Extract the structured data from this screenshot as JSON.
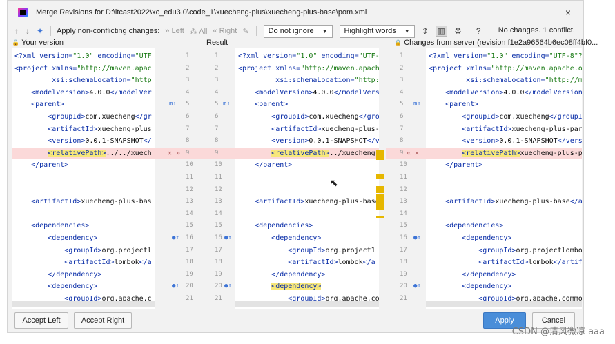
{
  "window": {
    "title": "Merge Revisions for D:\\itcast2022\\xc_edu3.0\\code_1\\xuecheng-plus\\xuecheng-plus-base\\pom.xml",
    "close_icon": "×"
  },
  "toolbar": {
    "up_icon": "↑",
    "down_icon": "↓",
    "magic_icon": "✦",
    "apply_label": "Apply non-conflicting changes:",
    "left_label": "» Left",
    "all_label": "⁂ All",
    "right_label": "« Right",
    "ignore_dropdown": "Do not ignore",
    "highlight_dropdown": "Highlight words",
    "status_text": "No changes. 1 conflict.",
    "help_icon": "?"
  },
  "columns": {
    "left": "Your version",
    "center": "Result",
    "right": "Changes from server (revision f1e2a96564b6ec08ff4bf0..."
  },
  "editor_left": [
    {
      "n": "1",
      "segs": [
        [
          "pi",
          "<?xml version="
        ],
        [
          "val",
          "\"1.0\""
        ],
        [
          "pi",
          " encoding="
        ],
        [
          "val",
          "\"UTF"
        ]
      ]
    },
    {
      "n": "2",
      "segs": [
        [
          "tag",
          "<project"
        ],
        [
          "attr",
          " xmlns="
        ],
        [
          "val",
          "\"http://maven.apac"
        ]
      ]
    },
    {
      "n": "3",
      "segs": [
        [
          "attr",
          "         xsi:schemaLocation="
        ],
        [
          "val",
          "\"http"
        ]
      ]
    },
    {
      "n": "4",
      "segs": [
        [
          "txt",
          "    "
        ],
        [
          "tag",
          "<modelVersion>"
        ],
        [
          "txt",
          "4.0.0"
        ],
        [
          "tag",
          "</modelVer"
        ]
      ]
    },
    {
      "n": "5",
      "segs": [
        [
          "txt",
          "    "
        ],
        [
          "tag",
          "<parent>"
        ]
      ]
    },
    {
      "n": "6",
      "segs": [
        [
          "txt",
          "        "
        ],
        [
          "tag",
          "<groupId>"
        ],
        [
          "txt",
          "com.xuecheng"
        ],
        [
          "tag",
          "</gr"
        ]
      ]
    },
    {
      "n": "7",
      "segs": [
        [
          "txt",
          "        "
        ],
        [
          "tag",
          "<artifactId>"
        ],
        [
          "txt",
          "xuecheng-plus"
        ]
      ]
    },
    {
      "n": "8",
      "segs": [
        [
          "txt",
          "        "
        ],
        [
          "tag",
          "<version>"
        ],
        [
          "txt",
          "0.0.1-SNAPSHOT"
        ],
        [
          "tag",
          "</"
        ]
      ]
    },
    {
      "n": "9",
      "segs": [
        [
          "txt",
          "        "
        ],
        [
          "taghl",
          "<relativePath>"
        ],
        [
          "txt",
          "../../xuech"
        ]
      ],
      "conflict": true
    },
    {
      "n": "10",
      "segs": [
        [
          "txt",
          "    "
        ],
        [
          "tag",
          "</parent>"
        ]
      ]
    },
    {
      "n": "11",
      "segs": []
    },
    {
      "n": "12",
      "segs": []
    },
    {
      "n": "13",
      "segs": [
        [
          "txt",
          "    "
        ],
        [
          "tag",
          "<artifactId>"
        ],
        [
          "txt",
          "xuecheng-plus-bas"
        ]
      ]
    },
    {
      "n": "14",
      "segs": []
    },
    {
      "n": "15",
      "segs": [
        [
          "txt",
          "    "
        ],
        [
          "tag",
          "<dependencies>"
        ]
      ]
    },
    {
      "n": "16",
      "segs": [
        [
          "txt",
          "        "
        ],
        [
          "tag",
          "<dependency>"
        ]
      ]
    },
    {
      "n": "17",
      "segs": [
        [
          "txt",
          "            "
        ],
        [
          "tag",
          "<groupId>"
        ],
        [
          "txt",
          "org.projectl"
        ]
      ]
    },
    {
      "n": "18",
      "segs": [
        [
          "txt",
          "            "
        ],
        [
          "tag",
          "<artifactId>"
        ],
        [
          "txt",
          "lombok"
        ],
        [
          "tag",
          "</a"
        ]
      ]
    },
    {
      "n": "19",
      "segs": [
        [
          "txt",
          "        "
        ],
        [
          "tag",
          "</dependency>"
        ]
      ]
    },
    {
      "n": "20",
      "segs": [
        [
          "txt",
          "        "
        ],
        [
          "tag",
          "<dependency>"
        ]
      ]
    },
    {
      "n": "21",
      "segs": [
        [
          "txt",
          "            "
        ],
        [
          "tag",
          "<groupId>"
        ],
        [
          "txt",
          "org.apache.c"
        ]
      ]
    }
  ],
  "editor_center": [
    {
      "n": "1",
      "segs": [
        [
          "pi",
          "<?xml version="
        ],
        [
          "val",
          "\"1.0\""
        ],
        [
          "pi",
          " encoding="
        ],
        [
          "val",
          "\"UTF-8"
        ]
      ]
    },
    {
      "n": "2",
      "segs": [
        [
          "tag",
          "<project"
        ],
        [
          "attr",
          " xmlns="
        ],
        [
          "val",
          "\"http://maven.apache"
        ]
      ]
    },
    {
      "n": "3",
      "segs": [
        [
          "attr",
          "         xsi:schemaLocation="
        ],
        [
          "val",
          "\"http:/"
        ]
      ]
    },
    {
      "n": "4",
      "segs": [
        [
          "txt",
          "    "
        ],
        [
          "tag",
          "<modelVersion>"
        ],
        [
          "txt",
          "4.0.0"
        ],
        [
          "tag",
          "</modelVersi"
        ]
      ]
    },
    {
      "n": "5",
      "segs": [
        [
          "txt",
          "    "
        ],
        [
          "tag",
          "<parent>"
        ]
      ]
    },
    {
      "n": "6",
      "segs": [
        [
          "txt",
          "        "
        ],
        [
          "tag",
          "<groupId>"
        ],
        [
          "txt",
          "com.xuecheng"
        ],
        [
          "tag",
          "</grou"
        ]
      ]
    },
    {
      "n": "7",
      "segs": [
        [
          "txt",
          "        "
        ],
        [
          "tag",
          "<artifactId>"
        ],
        [
          "txt",
          "xuecheng-plus-p"
        ]
      ]
    },
    {
      "n": "8",
      "segs": [
        [
          "txt",
          "        "
        ],
        [
          "tag",
          "<version>"
        ],
        [
          "txt",
          "0.0.1-SNAPSHOT"
        ],
        [
          "tag",
          "</ver"
        ]
      ]
    },
    {
      "n": "9",
      "segs": [
        [
          "txt",
          "        "
        ],
        [
          "taghl",
          "<relativePath>"
        ],
        [
          "txt",
          "../xuecheng"
        ]
      ],
      "conflict": true
    },
    {
      "n": "10",
      "segs": [
        [
          "txt",
          "    "
        ],
        [
          "tag",
          "</parent>"
        ]
      ]
    },
    {
      "n": "11",
      "segs": []
    },
    {
      "n": "12",
      "segs": []
    },
    {
      "n": "13",
      "segs": [
        [
          "txt",
          "    "
        ],
        [
          "tag",
          "<artifactId>"
        ],
        [
          "txt",
          "xuecheng-plus-base"
        ]
      ]
    },
    {
      "n": "14",
      "segs": []
    },
    {
      "n": "15",
      "segs": [
        [
          "txt",
          "    "
        ],
        [
          "tag",
          "<dependencies>"
        ]
      ]
    },
    {
      "n": "16",
      "segs": [
        [
          "txt",
          "        "
        ],
        [
          "tag",
          "<dependency>"
        ]
      ]
    },
    {
      "n": "17",
      "segs": [
        [
          "txt",
          "            "
        ],
        [
          "tag",
          "<groupId>"
        ],
        [
          "txt",
          "org.project1"
        ]
      ]
    },
    {
      "n": "18",
      "segs": [
        [
          "txt",
          "            "
        ],
        [
          "tag",
          "<artifactId>"
        ],
        [
          "txt",
          "lombok"
        ],
        [
          "tag",
          "</a"
        ]
      ]
    },
    {
      "n": "19",
      "segs": [
        [
          "txt",
          "        "
        ],
        [
          "tag",
          "</dependency>"
        ]
      ]
    },
    {
      "n": "20",
      "segs": [
        [
          "txt",
          "        "
        ],
        [
          "taghl",
          "<dependency>"
        ]
      ]
    },
    {
      "n": "21",
      "segs": [
        [
          "txt",
          "            "
        ],
        [
          "tag",
          "<groupId>"
        ],
        [
          "txt",
          "org.apache.com"
        ]
      ]
    }
  ],
  "editor_right": [
    {
      "n": "1",
      "segs": [
        [
          "pi",
          "<?xml version="
        ],
        [
          "val",
          "\"1.0\""
        ],
        [
          "pi",
          " encoding="
        ],
        [
          "val",
          "\"UTF-8\"?>"
        ]
      ]
    },
    {
      "n": "2",
      "segs": [
        [
          "tag",
          "<project"
        ],
        [
          "attr",
          " xmlns="
        ],
        [
          "val",
          "\"http://maven.apache.o"
        ]
      ]
    },
    {
      "n": "3",
      "segs": [
        [
          "attr",
          "         xsi:schemaLocation="
        ],
        [
          "val",
          "\"http://ma"
        ]
      ]
    },
    {
      "n": "4",
      "segs": [
        [
          "txt",
          "    "
        ],
        [
          "tag",
          "<modelVersion>"
        ],
        [
          "txt",
          "4.0.0"
        ],
        [
          "tag",
          "</modelVersion"
        ]
      ]
    },
    {
      "n": "5",
      "segs": [
        [
          "txt",
          "    "
        ],
        [
          "tag",
          "<parent>"
        ]
      ]
    },
    {
      "n": "6",
      "segs": [
        [
          "txt",
          "        "
        ],
        [
          "tag",
          "<groupId>"
        ],
        [
          "txt",
          "com.xuecheng"
        ],
        [
          "tag",
          "</groupId"
        ]
      ]
    },
    {
      "n": "7",
      "segs": [
        [
          "txt",
          "        "
        ],
        [
          "tag",
          "<artifactId>"
        ],
        [
          "txt",
          "xuecheng-plus-pare"
        ]
      ]
    },
    {
      "n": "8",
      "segs": [
        [
          "txt",
          "        "
        ],
        [
          "tag",
          "<version>"
        ],
        [
          "txt",
          "0.0.1-SNAPSHOT"
        ],
        [
          "tag",
          "</versi"
        ]
      ]
    },
    {
      "n": "9",
      "segs": [
        [
          "txt",
          "        "
        ],
        [
          "taghl",
          "<relativePath>"
        ],
        [
          "txt",
          "xuecheng-plus-pa"
        ]
      ],
      "conflict": true
    },
    {
      "n": "10",
      "segs": [
        [
          "txt",
          "    "
        ],
        [
          "tag",
          "</parent>"
        ]
      ]
    },
    {
      "n": "11",
      "segs": []
    },
    {
      "n": "12",
      "segs": []
    },
    {
      "n": "13",
      "segs": [
        [
          "txt",
          "    "
        ],
        [
          "tag",
          "<artifactId>"
        ],
        [
          "txt",
          "xuecheng-plus-base"
        ],
        [
          "tag",
          "</a"
        ]
      ]
    },
    {
      "n": "14",
      "segs": []
    },
    {
      "n": "15",
      "segs": [
        [
          "txt",
          "    "
        ],
        [
          "tag",
          "<dependencies>"
        ]
      ]
    },
    {
      "n": "16",
      "segs": [
        [
          "txt",
          "        "
        ],
        [
          "tag",
          "<dependency>"
        ]
      ]
    },
    {
      "n": "17",
      "segs": [
        [
          "txt",
          "            "
        ],
        [
          "tag",
          "<groupId>"
        ],
        [
          "txt",
          "org.projectlombok"
        ]
      ]
    },
    {
      "n": "18",
      "segs": [
        [
          "txt",
          "            "
        ],
        [
          "tag",
          "<artifactId>"
        ],
        [
          "txt",
          "lombok"
        ],
        [
          "tag",
          "</artifa"
        ]
      ]
    },
    {
      "n": "19",
      "segs": [
        [
          "txt",
          "        "
        ],
        [
          "tag",
          "</dependency>"
        ]
      ]
    },
    {
      "n": "20",
      "segs": [
        [
          "txt",
          "        "
        ],
        [
          "tag",
          "<dependency>"
        ]
      ]
    },
    {
      "n": "21",
      "segs": [
        [
          "txt",
          "            "
        ],
        [
          "tag",
          "<groupId>"
        ],
        [
          "txt",
          "org.apache.commor"
        ]
      ]
    }
  ],
  "gutter_markers": {
    "m_icon": "m↑",
    "left_conflict": "✕ »",
    "right_conflict": "« ✕",
    "dot_icon": "●↑"
  },
  "buttons": {
    "accept_left": "Accept Left",
    "accept_right": "Accept Right",
    "apply": "Apply",
    "cancel": "Cancel"
  },
  "watermark": "CSDN @清风微凉 aaa"
}
